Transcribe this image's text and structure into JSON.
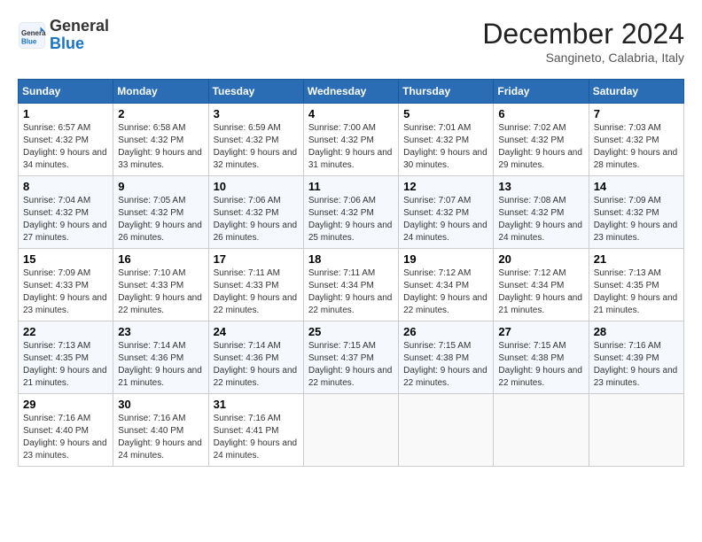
{
  "header": {
    "logo_text_general": "General",
    "logo_text_blue": "Blue",
    "month_title": "December 2024",
    "location": "Sangineto, Calabria, Italy"
  },
  "weekdays": [
    "Sunday",
    "Monday",
    "Tuesday",
    "Wednesday",
    "Thursday",
    "Friday",
    "Saturday"
  ],
  "weeks": [
    [
      {
        "day": "1",
        "sunrise": "6:57 AM",
        "sunset": "4:32 PM",
        "daylight": "9 hours and 34 minutes."
      },
      {
        "day": "2",
        "sunrise": "6:58 AM",
        "sunset": "4:32 PM",
        "daylight": "9 hours and 33 minutes."
      },
      {
        "day": "3",
        "sunrise": "6:59 AM",
        "sunset": "4:32 PM",
        "daylight": "9 hours and 32 minutes."
      },
      {
        "day": "4",
        "sunrise": "7:00 AM",
        "sunset": "4:32 PM",
        "daylight": "9 hours and 31 minutes."
      },
      {
        "day": "5",
        "sunrise": "7:01 AM",
        "sunset": "4:32 PM",
        "daylight": "9 hours and 30 minutes."
      },
      {
        "day": "6",
        "sunrise": "7:02 AM",
        "sunset": "4:32 PM",
        "daylight": "9 hours and 29 minutes."
      },
      {
        "day": "7",
        "sunrise": "7:03 AM",
        "sunset": "4:32 PM",
        "daylight": "9 hours and 28 minutes."
      }
    ],
    [
      {
        "day": "8",
        "sunrise": "7:04 AM",
        "sunset": "4:32 PM",
        "daylight": "9 hours and 27 minutes."
      },
      {
        "day": "9",
        "sunrise": "7:05 AM",
        "sunset": "4:32 PM",
        "daylight": "9 hours and 26 minutes."
      },
      {
        "day": "10",
        "sunrise": "7:06 AM",
        "sunset": "4:32 PM",
        "daylight": "9 hours and 26 minutes."
      },
      {
        "day": "11",
        "sunrise": "7:06 AM",
        "sunset": "4:32 PM",
        "daylight": "9 hours and 25 minutes."
      },
      {
        "day": "12",
        "sunrise": "7:07 AM",
        "sunset": "4:32 PM",
        "daylight": "9 hours and 24 minutes."
      },
      {
        "day": "13",
        "sunrise": "7:08 AM",
        "sunset": "4:32 PM",
        "daylight": "9 hours and 24 minutes."
      },
      {
        "day": "14",
        "sunrise": "7:09 AM",
        "sunset": "4:32 PM",
        "daylight": "9 hours and 23 minutes."
      }
    ],
    [
      {
        "day": "15",
        "sunrise": "7:09 AM",
        "sunset": "4:33 PM",
        "daylight": "9 hours and 23 minutes."
      },
      {
        "day": "16",
        "sunrise": "7:10 AM",
        "sunset": "4:33 PM",
        "daylight": "9 hours and 22 minutes."
      },
      {
        "day": "17",
        "sunrise": "7:11 AM",
        "sunset": "4:33 PM",
        "daylight": "9 hours and 22 minutes."
      },
      {
        "day": "18",
        "sunrise": "7:11 AM",
        "sunset": "4:34 PM",
        "daylight": "9 hours and 22 minutes."
      },
      {
        "day": "19",
        "sunrise": "7:12 AM",
        "sunset": "4:34 PM",
        "daylight": "9 hours and 22 minutes."
      },
      {
        "day": "20",
        "sunrise": "7:12 AM",
        "sunset": "4:34 PM",
        "daylight": "9 hours and 21 minutes."
      },
      {
        "day": "21",
        "sunrise": "7:13 AM",
        "sunset": "4:35 PM",
        "daylight": "9 hours and 21 minutes."
      }
    ],
    [
      {
        "day": "22",
        "sunrise": "7:13 AM",
        "sunset": "4:35 PM",
        "daylight": "9 hours and 21 minutes."
      },
      {
        "day": "23",
        "sunrise": "7:14 AM",
        "sunset": "4:36 PM",
        "daylight": "9 hours and 21 minutes."
      },
      {
        "day": "24",
        "sunrise": "7:14 AM",
        "sunset": "4:36 PM",
        "daylight": "9 hours and 22 minutes."
      },
      {
        "day": "25",
        "sunrise": "7:15 AM",
        "sunset": "4:37 PM",
        "daylight": "9 hours and 22 minutes."
      },
      {
        "day": "26",
        "sunrise": "7:15 AM",
        "sunset": "4:38 PM",
        "daylight": "9 hours and 22 minutes."
      },
      {
        "day": "27",
        "sunrise": "7:15 AM",
        "sunset": "4:38 PM",
        "daylight": "9 hours and 22 minutes."
      },
      {
        "day": "28",
        "sunrise": "7:16 AM",
        "sunset": "4:39 PM",
        "daylight": "9 hours and 23 minutes."
      }
    ],
    [
      {
        "day": "29",
        "sunrise": "7:16 AM",
        "sunset": "4:40 PM",
        "daylight": "9 hours and 23 minutes."
      },
      {
        "day": "30",
        "sunrise": "7:16 AM",
        "sunset": "4:40 PM",
        "daylight": "9 hours and 24 minutes."
      },
      {
        "day": "31",
        "sunrise": "7:16 AM",
        "sunset": "4:41 PM",
        "daylight": "9 hours and 24 minutes."
      },
      null,
      null,
      null,
      null
    ]
  ]
}
